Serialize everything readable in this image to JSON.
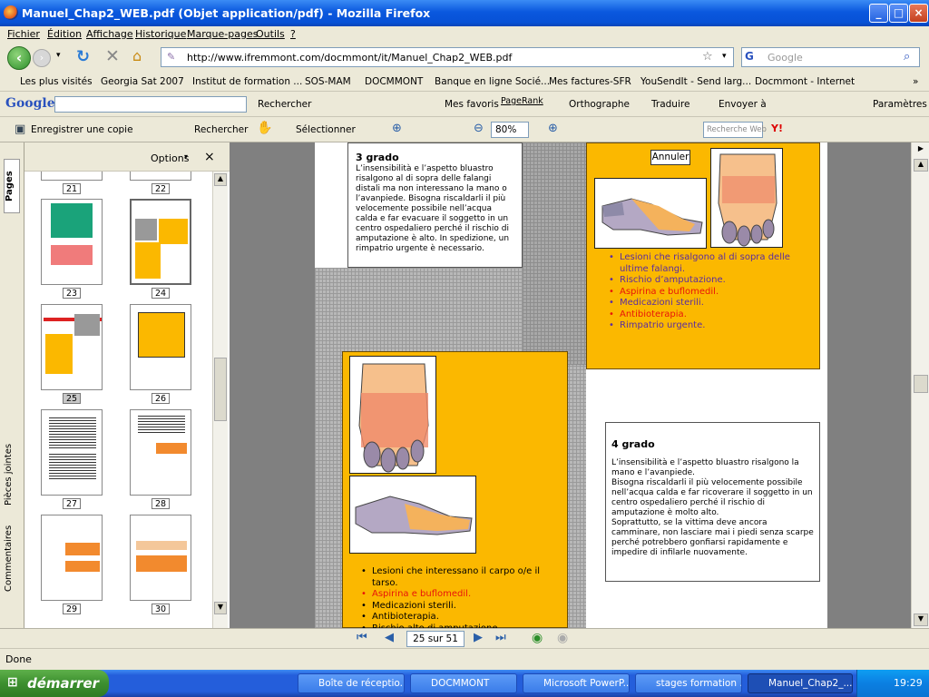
{
  "window": {
    "title": "Manuel_Chap2_WEB.pdf (Objet application/pdf) - Mozilla Firefox"
  },
  "menu": [
    "Fichier",
    "Édition",
    "Affichage",
    "Historique",
    "Marque-pages",
    "Outils",
    "?"
  ],
  "nav": {
    "url": "http://www.ifremmont.com/docmmont/it/Manuel_Chap2_WEB.pdf",
    "search_placeholder": "Google"
  },
  "bookmarks": [
    "Les plus visités",
    "Georgia Sat 2007",
    "Institut de formation ...",
    "SOS-MAM",
    "DOCMMONT",
    "Banque en ligne Socié...",
    "Mes factures-SFR",
    "YouSendIt - Send larg...",
    "Docmmont - Internet"
  ],
  "gtoolbar": {
    "logo": "Google",
    "search_button": "Rechercher",
    "favorites": "Mes favoris",
    "pagerank": "PageRank",
    "spelling": "Orthographe",
    "translate": "Traduire",
    "send": "Envoyer à",
    "settings": "Paramètres"
  },
  "pdftoolbar": {
    "save_copy": "Enregistrer une copie",
    "search": "Rechercher",
    "select": "Sélectionner",
    "zoom": "80%",
    "web_search_placeholder": "Recherche Web"
  },
  "panel": {
    "options": "Options",
    "close": "×",
    "tabs": [
      "Pages",
      "Pièces jointes",
      "Commentaires"
    ],
    "pages": [
      "21",
      "22",
      "23",
      "24",
      "25",
      "26",
      "27",
      "28",
      "29",
      "30"
    ],
    "selected": "25"
  },
  "doc": {
    "grade3": {
      "heading": "3 grado",
      "text": "L’insensibilità e l’aspetto bluastro risalgono al di sopra delle falangi distali ma non interessano la mano o l’avanpiede. Bisogna riscaldarli il più velocemente possibile nell’acqua calda e far evacuare il soggetto in un centro ospedaliero perché il rischio di amputazione è alto. In spedizione, un rimpatrio urgente è necessario."
    },
    "annuler": "Annuler",
    "list3": [
      {
        "text": "Lesioni che risalgono al di sopra delle ultime falangi.",
        "color": "purple"
      },
      {
        "text": "Rischio d’amputazione.",
        "color": "purple"
      },
      {
        "text": "Aspirina e buflomedil.",
        "color": "red"
      },
      {
        "text": "Medicazioni sterili.",
        "color": "purple"
      },
      {
        "text": "Antibioterapia.",
        "color": "red"
      },
      {
        "text": "Rimpatrio urgente.",
        "color": "purple"
      }
    ],
    "grade4": {
      "heading": "4 grado",
      "p1": "L’insensibilità e l’aspetto bluastro risalgono la mano e l’avanpiede.",
      "p2": "Bisogna riscaldarli il più velocemente possibile nell’acqua calda e far ricoverare il soggetto in un centro ospedaliero perché il rischio di amputazione è molto alto.",
      "p3": "Soprattutto, se la vittima deve ancora camminare, non lasciare mai i piedi senza scarpe perché potrebbero gonfiarsi rapidamente e impedire di infilarle nuovamente."
    },
    "list4": [
      {
        "text": "Lesioni che interessano il carpo o/e il tarso.",
        "color": "black"
      },
      {
        "text": "Aspirina e buflomedil.",
        "color": "red"
      },
      {
        "text": "Medicazioni sterili.",
        "color": "black"
      },
      {
        "text": "Antibioterapia.",
        "color": "black"
      },
      {
        "text": "Rischio alto di amputazione.",
        "color": "black"
      }
    ]
  },
  "pagenav": {
    "page": "25 sur 51"
  },
  "status": "Done",
  "taskbar": {
    "start": "démarrer",
    "tasks": [
      "Boîte de réceptio...",
      "DOCMMONT",
      "Microsoft PowerP...",
      "stages formation ...",
      "Manuel_Chap2_..."
    ],
    "time": "19:29"
  },
  "colors": {
    "orange": "#fbb800",
    "purple": "#5a2ca0",
    "red": "#e8140a",
    "grid": "#a8a8a8"
  }
}
